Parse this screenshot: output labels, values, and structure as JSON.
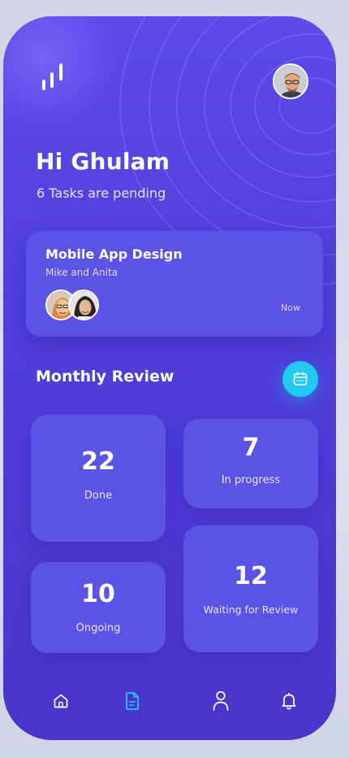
{
  "header": {
    "greeting": "Hi Ghulam",
    "subtitle": "6 Tasks are pending"
  },
  "task_card": {
    "title": "Mobile App Design",
    "members": "Mike and Anita",
    "time": "Now"
  },
  "monthly_review": {
    "title": "Monthly Review",
    "stats": {
      "done": {
        "value": "22",
        "label": "Done"
      },
      "in_progress": {
        "value": "7",
        "label": "In progress"
      },
      "ongoing": {
        "value": "10",
        "label": "Ongoing"
      },
      "waiting_review": {
        "value": "12",
        "label": "Waiting for Review"
      }
    }
  },
  "nav": {
    "items": [
      "home-icon",
      "document-icon",
      "profile-icon",
      "bell-icon"
    ],
    "active": "document-icon"
  },
  "colors": {
    "background": "#4f40dc",
    "card": "#5b52e6",
    "accent": "#22c8f0",
    "text": "#ffffff"
  }
}
